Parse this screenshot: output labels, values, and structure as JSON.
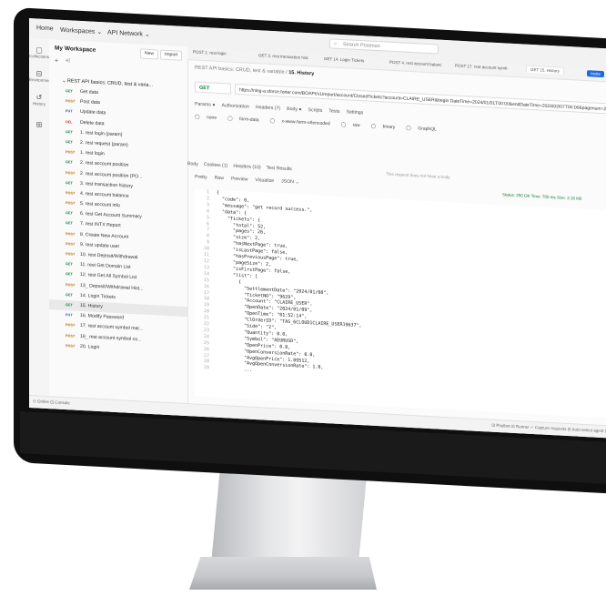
{
  "topbar": {
    "home": "Home",
    "workspaces": "Workspaces ⌄",
    "api_network": "API Network ⌄",
    "search_placeholder": "Search Postman"
  },
  "rail": {
    "collections": "Collections",
    "environments": "Environments",
    "history": "History"
  },
  "sidebar": {
    "workspace_title": "My Workspace",
    "new_label": "New",
    "import_label": "Import",
    "collection": "REST API basics: CRUD, test & varia...",
    "items": [
      {
        "method": "GET",
        "label": "Get data",
        "cls": "get"
      },
      {
        "method": "POST",
        "label": "Post data",
        "cls": "post"
      },
      {
        "method": "PUT",
        "label": "Update data",
        "cls": "put"
      },
      {
        "method": "DEL",
        "label": "Delete data",
        "cls": "del"
      },
      {
        "method": "GET",
        "label": "1. rest login (param)",
        "cls": "get"
      },
      {
        "method": "GET",
        "label": "2. rest request (param)",
        "cls": "get"
      },
      {
        "method": "POST",
        "label": "1. rest login",
        "cls": "post"
      },
      {
        "method": "GET",
        "label": "2. rest account position",
        "cls": "get"
      },
      {
        "method": "POST",
        "label": "2. rest account position (PO...",
        "cls": "post"
      },
      {
        "method": "GET",
        "label": "3. rest transaction history",
        "cls": "get"
      },
      {
        "method": "POST",
        "label": "4. rest account balance",
        "cls": "post"
      },
      {
        "method": "POST",
        "label": "5. rest account info",
        "cls": "post"
      },
      {
        "method": "GET",
        "label": "6. rest Get Account Summary",
        "cls": "get"
      },
      {
        "method": "GET",
        "label": "7. rest INTX Report",
        "cls": "get"
      },
      {
        "method": "POST",
        "label": "8. Create New Account",
        "cls": "post"
      },
      {
        "method": "POST",
        "label": "9. rest update user",
        "cls": "post"
      },
      {
        "method": "POST",
        "label": "10. rest Deposit/Withdrawal",
        "cls": "post"
      },
      {
        "method": "GET",
        "label": "11. rest Get Domain List",
        "cls": "get"
      },
      {
        "method": "GET",
        "label": "12. rest Get All Symbol List",
        "cls": "get"
      },
      {
        "method": "POST",
        "label": "13_ Deposit/Withdrawal Hist...",
        "cls": "post"
      },
      {
        "method": "GET",
        "label": "14. Login Tickets",
        "cls": "get"
      },
      {
        "method": "GET",
        "label": "15. History",
        "cls": "get",
        "selected": true
      },
      {
        "method": "PUT",
        "label": "16. Modify Password",
        "cls": "put"
      },
      {
        "method": "POST",
        "label": "17. rest account symbol mar...",
        "cls": "post"
      },
      {
        "method": "POST",
        "label": "18_ rest account symbol co...",
        "cls": "post"
      },
      {
        "method": "POST",
        "label": "20. Login",
        "cls": "post"
      }
    ]
  },
  "tabs": [
    "POST 1. rest login",
    "GET 3. rest transaction hist.",
    "GET 14. Login Tickets",
    "POST 4. rest account balanc",
    "POST 17. rest account symb",
    "GET 15. History"
  ],
  "invite": "Invite",
  "breadcrumb": {
    "path": "REST API basics: CRUD, test & variable /",
    "current": "15. History"
  },
  "request": {
    "method": "GET",
    "url": "https://ning-a.sforce.forter.com/BOAPI/v1/report/account/ClosedTickets?account=CLAIRE_USER&begin DateTime=2024/01/01T00:00&endDateTime=2024/02/07T00:00&pagenum=2&pagesize=2&symbol=EL",
    "subtabs": [
      "Params ●",
      "Authorization",
      "Headers (7)",
      "Body ●",
      "Scripts",
      "Tests",
      "Settings"
    ],
    "body_types": [
      "none",
      "form-data",
      "x-www-form-urlencoded",
      "raw",
      "binary",
      "GraphQL"
    ]
  },
  "response": {
    "tabs": [
      "Body",
      "Cookies (1)",
      "Headers (10)",
      "Test Results"
    ],
    "hint": "This request does not have a body",
    "formats": [
      "Pretty",
      "Raw",
      "Preview",
      "Visualize",
      "JSON ⌄"
    ],
    "status": "Status: 200 OK   Time: 705 ms   Size: 2.15 KB"
  },
  "code_lines": [
    "{",
    "  \"code\": 0,",
    "  \"message\": \"get record success.\",",
    "  \"data\": {",
    "    \"Tickets\": {",
    "      \"total\": 52,",
    "      \"pages\": 26,",
    "      \"size\": 2,",
    "      \"hasNextPage\": true,",
    "      \"isLastPage\": false,",
    "      \"hasPreviousPage\": true,",
    "      \"pageSize\": 2,",
    "      \"isFirstPage\": false,",
    "      \"list\": [",
    "        {",
    "          \"SettlementDate\": \"2024/01/08\",",
    "          \"TicketNO\": \"9629\",",
    "          \"Account\": \"CLAIRE_USER\",",
    "          \"OpenDate\": \"2024/01/09\",",
    "          \"OpenTime\": \"01:52:14\",",
    "          \"ClOrderID\": \"TAS_6CLOUD1CLAIRE_USER19637\",",
    "          \"Side\": \"2\",",
    "          \"Quantity\": 0.0,",
    "          \"Symbol\": \"AEURUSD\",",
    "          \"OpenPrice\": 0.0,",
    "          \"OpenConversionRate\": 0.0,",
    "          \"AvgOpenPrice\": 1.09512,",
    "          \"AvgOpenConversionRate\": 1.0,",
    "          ..."
  ],
  "statusbar": {
    "left": "⊙ Online  ⊡ Console",
    "right": "⊡ Postbot   ⊡ Runner   ✓ Capture requests   ⊡ Auto-select agent   ⊡ Cookies"
  }
}
